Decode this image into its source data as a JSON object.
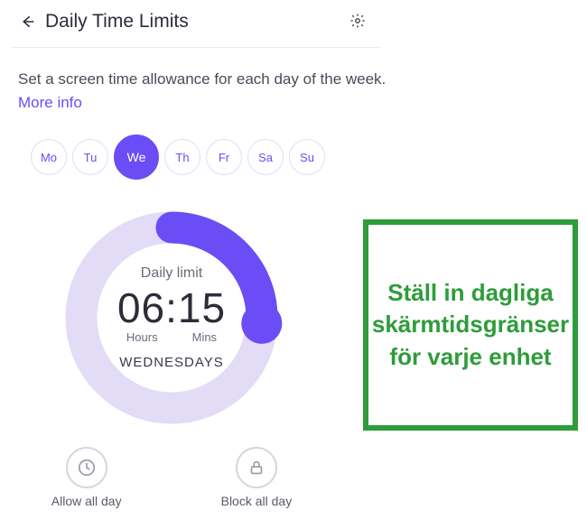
{
  "header": {
    "title": "Daily Time Limits"
  },
  "description": {
    "text": "Set a screen time allowance for each day of the week. ",
    "more_info": "More info"
  },
  "days": [
    {
      "short": "Mo",
      "selected": false
    },
    {
      "short": "Tu",
      "selected": false
    },
    {
      "short": "We",
      "selected": true
    },
    {
      "short": "Th",
      "selected": false
    },
    {
      "short": "Fr",
      "selected": false
    },
    {
      "short": "Sa",
      "selected": false
    },
    {
      "short": "Su",
      "selected": false
    }
  ],
  "dial": {
    "label": "Daily limit",
    "time": "06:15",
    "hours_label": "Hours",
    "mins_label": "Mins",
    "day_name": "WEDNESDAYS",
    "fraction": 0.26
  },
  "actions": {
    "allow": "Allow all day",
    "block": "Block all day"
  },
  "callout": {
    "text": "Ställ in dagliga skärmtidsgränser för varje enhet"
  },
  "colors": {
    "accent": "#6a4df5",
    "track": "#e2dcf7",
    "callout_green": "#2e9c3a"
  }
}
